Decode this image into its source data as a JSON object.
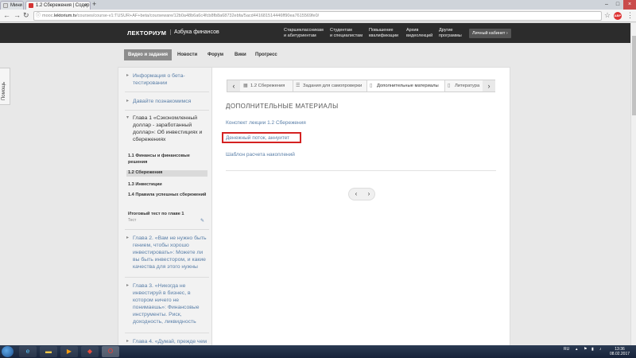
{
  "browser": {
    "tabs": [
      {
        "title": "Мини",
        "favicon_color": "#e2e2e2"
      },
      {
        "title": "1.2 Сбережения | Содер",
        "favicon_color": "#d33333"
      }
    ],
    "new_tab": "+",
    "url_prefix": "mooc.",
    "url_domain": "lektorium.tv",
    "url_path": "/courses/course-v1:TUSUR+AF+beta/courseware/12b0a48b6a6c4fcb8fb8a68732ebfa/5acd441681514446ff90ea7615569fe0/",
    "window_controls": [
      "–",
      "□",
      "×"
    ],
    "ext_badge": "ABP"
  },
  "site": {
    "logo": "ЛЕКТОРИУМ",
    "course_name": "Азбука финансов",
    "header_links": [
      {
        "line1": "Старшеклассникам",
        "line2": "и абитуриентам"
      },
      {
        "line1": "Студентам",
        "line2": "и специалистам"
      },
      {
        "line1": "Повышение",
        "line2": "квалификации"
      },
      {
        "line1": "Архив",
        "line2": "видеолекций"
      },
      {
        "line1": "Другие",
        "line2": "программы"
      }
    ],
    "cabinet": "Личный кабинет ›"
  },
  "course_nav": [
    "Видео и задания",
    "Новости",
    "Форум",
    "Вики",
    "Прогресс"
  ],
  "help_tab": "Помощь",
  "sidebar": {
    "chapters": [
      {
        "title": "Информация о бета-тестировании"
      },
      {
        "title": "Давайте познакомимся"
      },
      {
        "title": "Глава 1 «Сэкономленный доллар - заработанный доллар»: Об инвестициях и сбережениях"
      },
      {
        "title": "Глава 2. «Вам не нужно быть гением, чтобы хорошо инвестировать»: Можете ли вы быть инвестором, и какие качества для этого нужны"
      },
      {
        "title": "Глава 3. «Никогда не инвестируй в бизнес, в котором ничего не понимаешь»: Финансовые инструменты. Риск, доходность, ликвидность"
      },
      {
        "title": "Глава 4. «Думай, прежде чем"
      }
    ],
    "sections": [
      {
        "title": "1.1 Финансы и финансовые решения"
      },
      {
        "title": "1.2 Сбережения"
      },
      {
        "title": "1.3 Инвестиции"
      },
      {
        "title": "1.4 Правила успешных сбережений"
      },
      {
        "title": "Итоговый тест по главе 1",
        "sub": "Тест"
      }
    ]
  },
  "sequence": {
    "tabs": [
      {
        "icon": "▦",
        "label": "1.2 Сбережения"
      },
      {
        "icon": "☰",
        "label": "Задания для самопроверки"
      },
      {
        "icon": "▯",
        "label": "Дополнительные материалы"
      },
      {
        "icon": "▯",
        "label": "Литература"
      }
    ]
  },
  "content": {
    "heading": "ДОПОЛНИТЕЛЬНЫЕ МАТЕРИАЛЫ",
    "links": [
      "Конспект лекции 1.2 Сбережения",
      "Денежный поток, аннуитет",
      "Шаблон расчета накоплений"
    ]
  },
  "taskbar": {
    "lang": "RU",
    "time": "13:36",
    "date": "08.02.2017",
    "apps": [
      "ie",
      "folder",
      "media",
      "paint",
      "opera"
    ]
  }
}
